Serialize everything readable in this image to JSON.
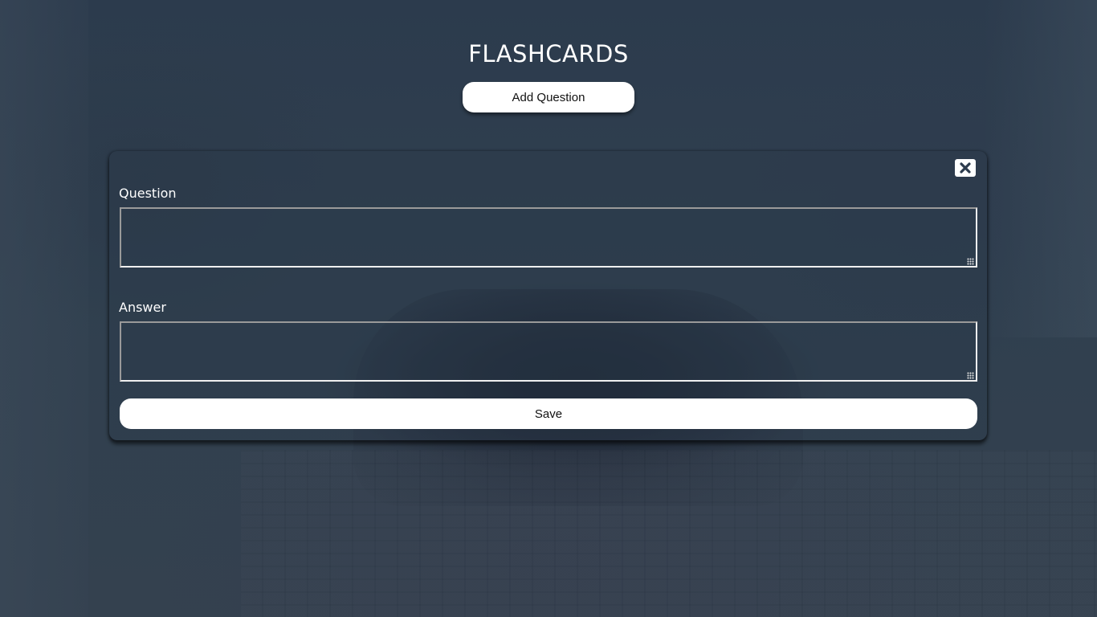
{
  "app": {
    "title": "FLASHCARDS"
  },
  "header": {
    "add_question_label": "Add Question"
  },
  "form": {
    "close_icon": "close-icon",
    "question": {
      "label": "Question",
      "value": "",
      "placeholder": ""
    },
    "answer": {
      "label": "Answer",
      "value": "",
      "placeholder": ""
    },
    "save_label": "Save"
  },
  "colors": {
    "background": "#2f3e4f",
    "button_bg": "#ffffff",
    "button_text": "#111111",
    "text": "#ffffff"
  }
}
